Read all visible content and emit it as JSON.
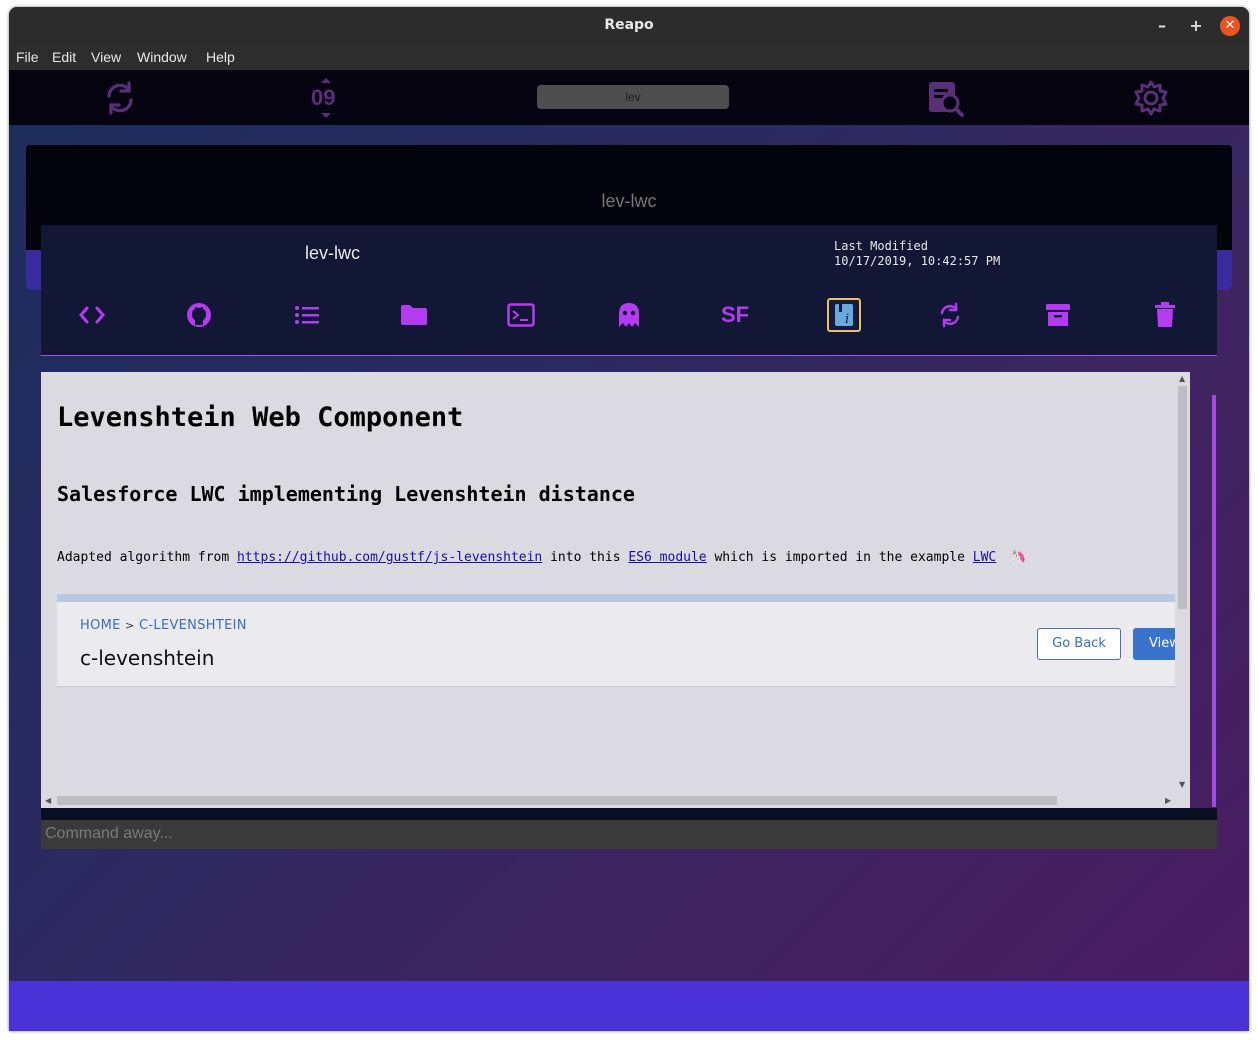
{
  "window": {
    "title": "Reapo",
    "controls": {
      "minimize": "–",
      "maximize": "+",
      "close": "✕"
    }
  },
  "menu": [
    "File",
    "Edit",
    "View",
    "Window",
    "Help"
  ],
  "toolbar": {
    "sync_icon": "refresh-icon",
    "count_label": "09",
    "search_value": "lev",
    "search_icon": "search-document-icon",
    "settings_icon": "gear-icon"
  },
  "repo_card": {
    "title": "lev-lwc"
  },
  "repo_panel": {
    "name": "lev-lwc",
    "last_modified_label": "Last Modified",
    "last_modified_value": "10/17/2019, 10:42:57 PM",
    "actions": [
      "code-icon",
      "github-icon",
      "list-icon",
      "folder-icon",
      "terminal-icon",
      "ghost-icon",
      "salesforce-sf",
      "readme-info-icon",
      "refresh-icon",
      "archive-icon",
      "trash-icon"
    ],
    "sf_label": "SF"
  },
  "readme": {
    "h1": "Levenshtein Web Component",
    "h2": "Salesforce LWC implementing Levenshtein distance",
    "para_prefix": "Adapted algorithm from ",
    "link1": "https://github.com/gustf/js-levenshtein",
    "para_mid1": " into this ",
    "link2": "ES6 module",
    "para_mid2": " which is imported in the example ",
    "link3": "LWC",
    "emoji": "🦄",
    "embed": {
      "crumb_home": "HOME",
      "crumb_sep": ">",
      "crumb_current": "C-LEVENSHTEIN",
      "title": "c-levenshtein",
      "go_back": "Go Back",
      "view": "View"
    }
  },
  "command": {
    "placeholder": "Command away..."
  },
  "colors": {
    "accent": "#b43cf0",
    "bottom_bar": "#4b31d8",
    "selected_border": "#e8c060"
  }
}
